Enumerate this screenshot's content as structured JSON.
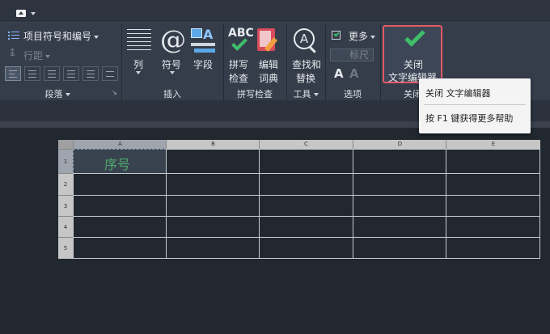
{
  "ribbon": {
    "paragraph": {
      "bullets_label": "项目符号和编号",
      "line_spacing_label": "行距",
      "panel_title": "段落"
    },
    "insert": {
      "column_label": "列",
      "symbol_label": "符号",
      "field_label": "字段",
      "panel_title": "插入"
    },
    "spellcheck": {
      "spellcheck_label_1": "拼写",
      "spellcheck_label_2": "检查",
      "edit_dict_label_1": "编辑",
      "edit_dict_label_2": "词典",
      "abc_text": "ABC",
      "panel_title": "拼写检查"
    },
    "tools": {
      "find_label_1": "查找和",
      "find_label_2": "替换",
      "panel_title": "工具"
    },
    "options": {
      "more_label": "更多",
      "ruler_label": "标尺",
      "panel_title": "选项"
    },
    "close": {
      "label_1": "关闭",
      "label_2": "文字编辑器",
      "panel_title": "关闭"
    }
  },
  "tooltip": {
    "title": "关闭 文字编辑器",
    "help": "按 F1 键获得更多帮助"
  },
  "table": {
    "columns": [
      "A",
      "B",
      "C",
      "D",
      "E"
    ],
    "rows": [
      "1",
      "2",
      "3",
      "4",
      "5"
    ],
    "selected_cell_text": "序号"
  },
  "colors": {
    "accent_close": "#e35a66",
    "check_green": "#3fbf6a",
    "cell_text": "#4eaa6e"
  }
}
